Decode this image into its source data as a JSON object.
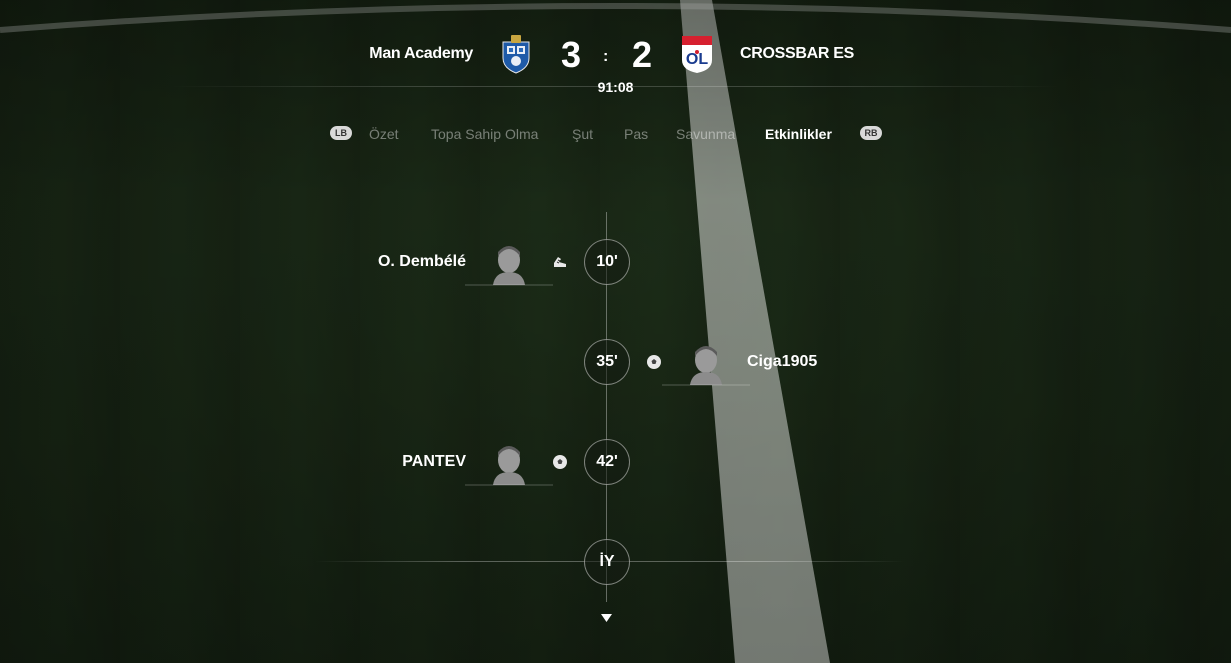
{
  "match": {
    "home_team": "Man Academy",
    "away_team": "CROSSBAR ES",
    "home_score": "3",
    "away_score": "2",
    "separator": ":",
    "clock": "91:08"
  },
  "tabs": {
    "left_bumper": "LB",
    "right_bumper": "RB",
    "items": [
      {
        "label": "Özet",
        "active": false
      },
      {
        "label": "Topa Sahip Olma",
        "active": false
      },
      {
        "label": "Şut",
        "active": false
      },
      {
        "label": "Pas",
        "active": false
      },
      {
        "label": "Savunma",
        "active": false
      },
      {
        "label": "Etkinlikler",
        "active": true
      }
    ]
  },
  "events": [
    {
      "minute": "10'",
      "side": "home",
      "player": "O. Dembélé",
      "type": "assist"
    },
    {
      "minute": "35'",
      "side": "away",
      "player": "Ciga1905",
      "type": "goal"
    },
    {
      "minute": "42'",
      "side": "home",
      "player": "PANTEV",
      "type": "goal"
    }
  ],
  "half_marker": "İY",
  "colors": {
    "pitch": "#1c2b18",
    "text": "#ffffff",
    "inactive_tab": "#8a8f88",
    "home_crest_blue": "#1e5aa8",
    "away_crest_red": "#d6202f"
  },
  "icons": {
    "assist": "boot-icon",
    "goal": "ball-icon",
    "scroll": "chevron-down-icon"
  }
}
